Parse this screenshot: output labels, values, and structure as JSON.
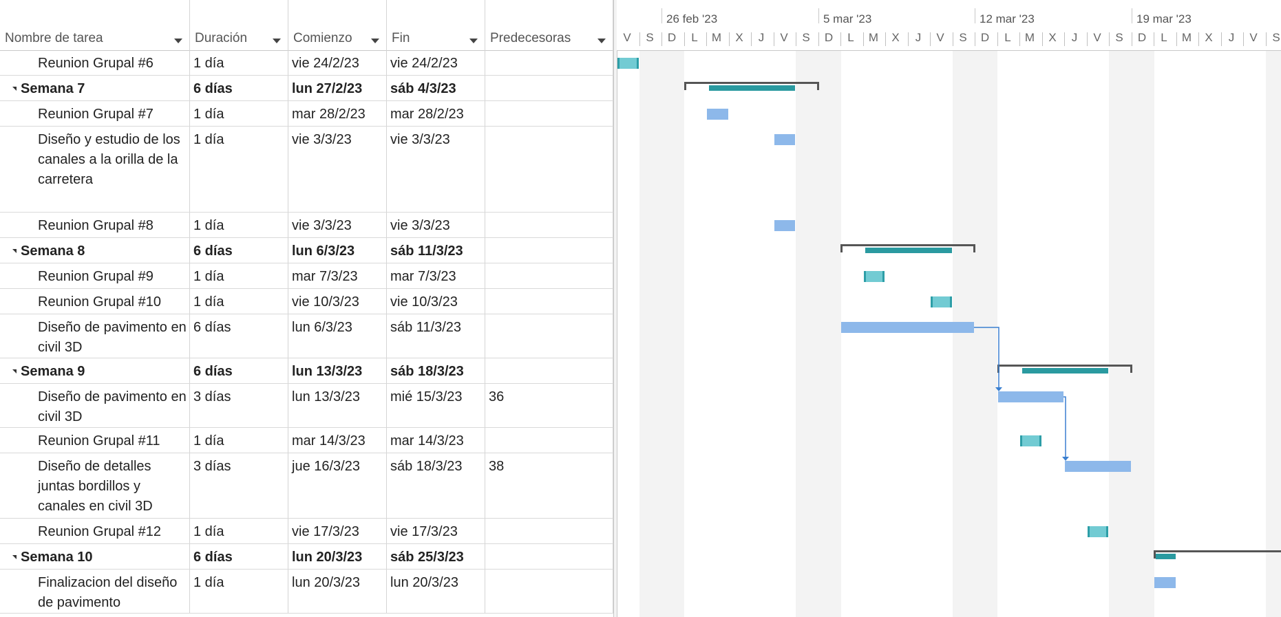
{
  "columns": [
    {
      "label": "Nombre de tarea",
      "dropdown": true
    },
    {
      "label": "Duración",
      "dropdown": true
    },
    {
      "label": "Comienzo",
      "dropdown": true
    },
    {
      "label": "Fin",
      "dropdown": true
    },
    {
      "label": "Predecesoras",
      "dropdown": true
    }
  ],
  "rows": [
    {
      "name": "Reunion Grupal #6",
      "duration": "1 día",
      "start": "vie 24/2/23",
      "end": "vie 24/2/23",
      "pred": "",
      "summary": false,
      "bar": "meeting",
      "bar_start_day": 0,
      "bar_days": 1
    },
    {
      "name": "Semana 7",
      "duration": "6 días",
      "start": "lun 27/2/23",
      "end": "sáb 4/3/23",
      "pred": "",
      "summary": true,
      "bar": "summary",
      "bar_start_day": 3,
      "bar_days": 6
    },
    {
      "name": "Reunion Grupal #7",
      "duration": "1 día",
      "start": "mar 28/2/23",
      "end": "mar 28/2/23",
      "pred": "",
      "summary": false,
      "bar": "task",
      "bar_start_day": 4,
      "bar_days": 1
    },
    {
      "name": "Diseño y estudio de los canales a la orilla de la carretera",
      "duration": "1 día",
      "start": "vie 3/3/23",
      "end": "vie 3/3/23",
      "pred": "",
      "summary": false,
      "bar": "task",
      "bar_start_day": 7,
      "bar_days": 1
    },
    {
      "name": "Reunion Grupal #8",
      "duration": "1 día",
      "start": "vie 3/3/23",
      "end": "vie 3/3/23",
      "pred": "",
      "summary": false,
      "bar": "task",
      "bar_start_day": 7,
      "bar_days": 1
    },
    {
      "name": "Semana 8",
      "duration": "6 días",
      "start": "lun 6/3/23",
      "end": "sáb 11/3/23",
      "pred": "",
      "summary": true,
      "bar": "summary",
      "bar_start_day": 10,
      "bar_days": 6
    },
    {
      "name": "Reunion Grupal #9",
      "duration": "1 día",
      "start": "mar 7/3/23",
      "end": "mar 7/3/23",
      "pred": "",
      "summary": false,
      "bar": "meeting",
      "bar_start_day": 11,
      "bar_days": 1
    },
    {
      "name": "Reunion Grupal #10",
      "duration": "1 día",
      "start": "vie 10/3/23",
      "end": "vie 10/3/23",
      "pred": "",
      "summary": false,
      "bar": "meeting",
      "bar_start_day": 14,
      "bar_days": 1
    },
    {
      "name": "Diseño de pavimento en civil 3D",
      "duration": "6 días",
      "start": "lun 6/3/23",
      "end": "sáb 11/3/23",
      "pred": "",
      "summary": false,
      "bar": "task",
      "bar_start_day": 10,
      "bar_days": 6
    },
    {
      "name": "Semana 9",
      "duration": "6 días",
      "start": "lun 13/3/23",
      "end": "sáb 18/3/23",
      "pred": "",
      "summary": true,
      "bar": "summary",
      "bar_start_day": 17,
      "bar_days": 6
    },
    {
      "name": "Diseño de pavimento en civil 3D",
      "duration": "3 días",
      "start": "lun 13/3/23",
      "end": "mié 15/3/23",
      "pred": "36",
      "summary": false,
      "bar": "task",
      "bar_start_day": 17,
      "bar_days": 3
    },
    {
      "name": "Reunion Grupal #11",
      "duration": "1 día",
      "start": "mar 14/3/23",
      "end": "mar 14/3/23",
      "pred": "",
      "summary": false,
      "bar": "meeting",
      "bar_start_day": 18,
      "bar_days": 1
    },
    {
      "name": "Diseño de detalles juntas bordillos y canales en civil 3D",
      "duration": "3 días",
      "start": "jue 16/3/23",
      "end": "sáb 18/3/23",
      "pred": "38",
      "summary": false,
      "bar": "task",
      "bar_start_day": 20,
      "bar_days": 3
    },
    {
      "name": "Reunion Grupal #12",
      "duration": "1 día",
      "start": "vie 17/3/23",
      "end": "vie 17/3/23",
      "pred": "",
      "summary": false,
      "bar": "meeting",
      "bar_start_day": 21,
      "bar_days": 1
    },
    {
      "name": "Semana 10",
      "duration": "6 días",
      "start": "lun 20/3/23",
      "end": "sáb 25/3/23",
      "pred": "",
      "summary": true,
      "bar": "summary",
      "bar_start_day": 24,
      "bar_days": 6,
      "bar_progress_days": 1
    },
    {
      "name": "Finalizacion del diseño de pavimento",
      "duration": "1 día",
      "start": "lun 20/3/23",
      "end": "lun 20/3/23",
      "pred": "",
      "summary": false,
      "bar": "task",
      "bar_start_day": 24,
      "bar_days": 1
    }
  ],
  "timescale": {
    "weeks": [
      "26 feb '23",
      "5 mar '23",
      "12 mar '23",
      "19 mar '23"
    ],
    "days": [
      "V",
      "S",
      "D",
      "L",
      "M",
      "X",
      "J",
      "V",
      "S",
      "D",
      "L",
      "M",
      "X",
      "J",
      "V",
      "S",
      "D",
      "L",
      "M",
      "X",
      "J",
      "V",
      "S",
      "D",
      "L",
      "M",
      "X",
      "J",
      "V",
      "S"
    ]
  },
  "links": [
    {
      "from_row": 8,
      "to_row": 10
    },
    {
      "from_row": 10,
      "to_row": 12
    }
  ],
  "colors": {
    "task_bar": "#8db8ea",
    "meeting_bar": "#72cbd3",
    "summary_bar": "#2a9aa0",
    "link": "#3a7fd0"
  }
}
